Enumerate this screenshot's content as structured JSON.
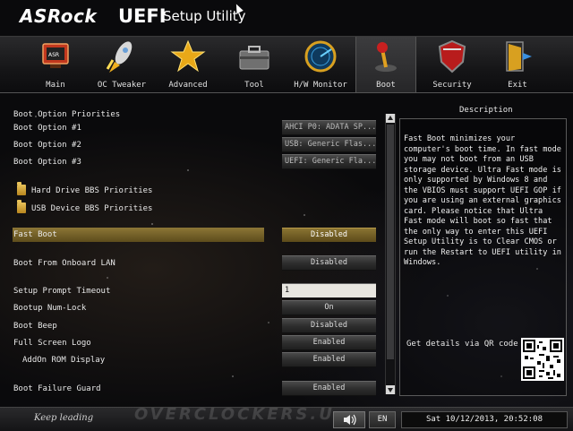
{
  "header": {
    "brand": "ASRock",
    "title_bold": "UEFI",
    "title_rest": "Setup Utility"
  },
  "tabs": [
    {
      "label": "Main",
      "icon": "monitor-icon"
    },
    {
      "label": "OC Tweaker",
      "icon": "rocket-icon"
    },
    {
      "label": "Advanced",
      "icon": "star-icon"
    },
    {
      "label": "Tool",
      "icon": "toolbox-icon"
    },
    {
      "label": "H/W Monitor",
      "icon": "radar-icon"
    },
    {
      "label": "Boot",
      "icon": "joystick-icon"
    },
    {
      "label": "Security",
      "icon": "shield-icon"
    },
    {
      "label": "Exit",
      "icon": "exit-door-icon"
    }
  ],
  "active_tab": "Boot",
  "settings": {
    "boot_option_priorities": "Boot Option Priorities",
    "boot_option_1": {
      "label": "Boot Option #1",
      "value": "AHCI P0: ADATA SP..."
    },
    "boot_option_2": {
      "label": "Boot Option #2",
      "value": "USB: Generic Flas..."
    },
    "boot_option_3": {
      "label": "Boot Option #3",
      "value": "UEFI: Generic Fla..."
    },
    "hdd_bbs": "Hard Drive BBS Priorities",
    "usb_bbs": "USB Device BBS Priorities",
    "fast_boot": {
      "label": "Fast Boot",
      "value": "Disabled"
    },
    "onboard_lan": {
      "label": "Boot From Onboard LAN",
      "value": "Disabled"
    },
    "prompt_timeout": {
      "label": "Setup Prompt Timeout",
      "value": "1"
    },
    "numlock": {
      "label": "Bootup Num-Lock",
      "value": "On"
    },
    "boot_beep": {
      "label": "Boot Beep",
      "value": "Disabled"
    },
    "full_screen_logo": {
      "label": "Full Screen Logo",
      "value": "Enabled"
    },
    "addon_rom": {
      "label": "AddOn ROM Display",
      "value": "Enabled"
    },
    "failure_guard": {
      "label": "Boot Failure Guard",
      "value": "Enabled"
    }
  },
  "description": {
    "title": "Description",
    "text": "Fast Boot minimizes your computer's boot time. In fast mode you may not boot from an USB storage device. Ultra Fast mode is only supported by Windows 8 and the VBIOS must support UEFI GOP if you are using an external graphics card. Please notice that Ultra Fast mode will boot so fast that the only way to enter this UEFI Setup Utility is to Clear CMOS or run the Restart to UEFI utility in Windows.",
    "qr_label": "Get details via QR code"
  },
  "footer": {
    "slogan": "Keep leading",
    "watermark": "OVERCLOCKERS.U",
    "language": "EN",
    "datetime": "Sat 10/12/2013, 20:52:08"
  },
  "colors": {
    "highlight": "#7a6630",
    "selected_value": "#6e5a24",
    "background": "#0a0a0c"
  }
}
